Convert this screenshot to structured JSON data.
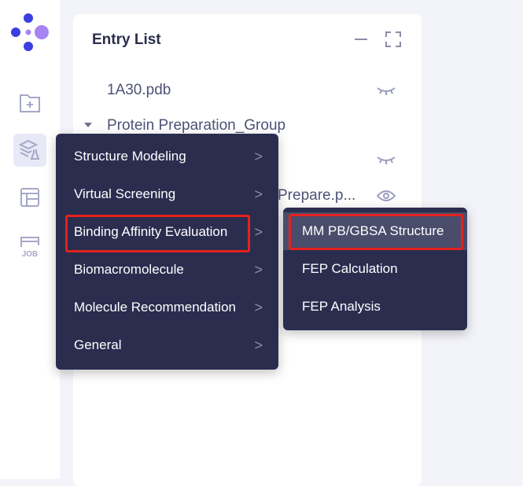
{
  "sidebar": {
    "items": [
      {
        "icon": "folder-add-icon"
      },
      {
        "icon": "layers-flask-icon",
        "active": true
      },
      {
        "icon": "layout-icon"
      },
      {
        "icon": "job-icon",
        "label": "JOB"
      }
    ]
  },
  "panel": {
    "title": "Entry List",
    "entries": [
      "1A30.pdb",
      "Protein Preparation_Group",
      "Prepare.p..."
    ]
  },
  "menu": {
    "items": [
      "Structure Modeling",
      "Virtual Screening",
      "Binding Affinity Evaluation",
      "Biomacromolecule",
      "Molecule Recommendation",
      "General"
    ],
    "highlighted": "Binding Affinity Evaluation"
  },
  "submenu": {
    "items": [
      "MM PB/GBSA Structure",
      "FEP Calculation",
      "FEP Analysis"
    ],
    "highlighted": "MM PB/GBSA Structure"
  },
  "colors": {
    "menu_bg": "#2b2d4f",
    "highlight": "#e5211d",
    "logo_blue": "#3b3fe0",
    "logo_purple": "#a883f2"
  }
}
